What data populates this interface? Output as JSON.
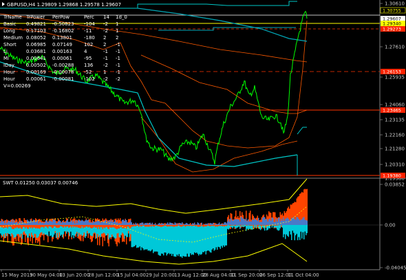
{
  "header": {
    "symbol_line": "GBPUSD,H4  1.29809 1.29868 1.29578 1.29607"
  },
  "table": {
    "columns": [
      "TrName",
      "TrPower",
      "PerPow",
      "Perc",
      "14",
      "1d_0"
    ],
    "rows": [
      [
        "Basic",
        "0.49821",
        "-0.50823",
        "-104",
        "-2",
        "1"
      ],
      [
        "Long",
        "0.17103",
        "-0.16802",
        "-11",
        "-2",
        "1"
      ],
      [
        "Medium",
        "0.08052",
        "0.13801",
        "-180",
        "2",
        "2"
      ],
      [
        "Short",
        "0.06985",
        "0.07149",
        "102",
        "2",
        "-1"
      ],
      [
        "Li",
        "0.03681",
        "0.00163",
        "4",
        "-1",
        "-1"
      ],
      [
        "Mi",
        "0.00641",
        "0.00061",
        "-95",
        "-1",
        "-1"
      ],
      [
        "IDay",
        "0.00502",
        "-0.00288",
        "136",
        "-2",
        "-1"
      ],
      [
        "Hour",
        "0.00169",
        "-0.00078",
        "-52",
        "1",
        "-1"
      ],
      [
        "Hour",
        "0.00061",
        "-0.00081",
        "-102",
        "-2",
        "-2"
      ]
    ],
    "total": "V=0.00269"
  },
  "price_axis": {
    "ticks": [
      "1.30610",
      "1.29340",
      "1.27610",
      "1.25935",
      "1.24060",
      "1.23135",
      "1.22160",
      "1.21280",
      "1.20310",
      "1.19380"
    ],
    "badges": [
      {
        "text": "1.30755",
        "color": "#ffff00",
        "bg": "#000000"
      },
      {
        "text": "1.29607",
        "color": "#000000",
        "bg": "#ffffff"
      },
      {
        "text": "1.29340",
        "color": "#000000",
        "bg": "#ffff00"
      },
      {
        "text": "1.29273",
        "color": "#ffffff",
        "bg": "#ff2200"
      },
      {
        "text": "1.26153",
        "color": "#ffffff",
        "bg": "#ff2200"
      },
      {
        "text": "1.23465",
        "color": "#ffffff",
        "bg": "#ff2200"
      },
      {
        "text": "1.19380",
        "color": "#ffffff",
        "bg": "#ff2200"
      }
    ]
  },
  "indicator": {
    "label": "SWT 0.01250 0.03037 0.00746",
    "ticks": [
      "0.03852",
      "0.00",
      "-0.04045"
    ]
  },
  "time_axis": {
    "labels": [
      "15 May 2019",
      "30 May 04:00",
      "13 Jun 20:00",
      "28 Jun 12:00",
      "15 Jul 04:00",
      "29 Jul 20:00",
      "13 Aug 12:00",
      "28 Aug 04:00",
      "11 Sep 20:00",
      "26 Sep 12:00",
      "11 Oct 04:00"
    ]
  },
  "colors": {
    "price": "#00ff00",
    "ma_slow": "#00c8c8",
    "envelope": "#ff5a00",
    "band": "#ffff00",
    "hist_red": "#ff4400",
    "hist_cyan": "#00c8d8",
    "hist_blue": "#4a78c8"
  }
}
